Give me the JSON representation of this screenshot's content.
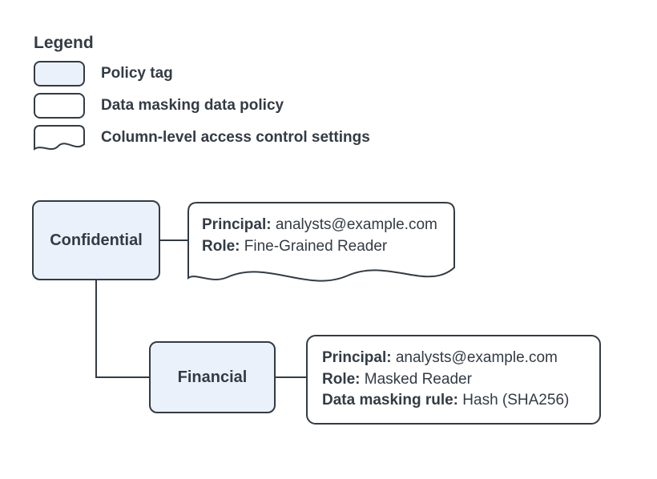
{
  "legend": {
    "title": "Legend",
    "items": [
      {
        "label": "Policy tag"
      },
      {
        "label": "Data masking data policy"
      },
      {
        "label": "Column-level access control settings"
      }
    ]
  },
  "nodes": {
    "confidential": {
      "label": "Confidential"
    },
    "financial": {
      "label": "Financial"
    },
    "confidential_settings": {
      "principal_label": "Principal:",
      "principal_value": " analysts@example.com",
      "role_label": "Role:",
      "role_value": " Fine-Grained Reader"
    },
    "financial_policy": {
      "principal_label": "Principal:",
      "principal_value": " analysts@example.com",
      "role_label": "Role:",
      "role_value": " Masked Reader",
      "rule_label": "Data masking rule:",
      "rule_value": " Hash (SHA256)"
    }
  }
}
